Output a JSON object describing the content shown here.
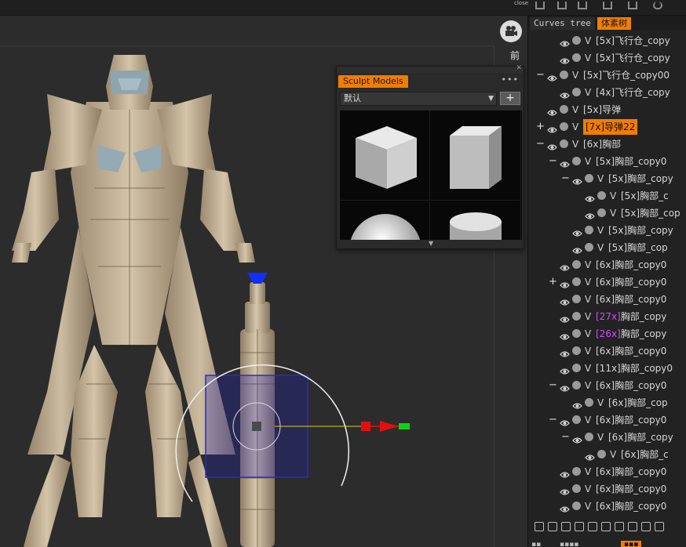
{
  "topbar": {
    "close_label": "close"
  },
  "viewport": {
    "view_label": "前"
  },
  "sculpt_panel": {
    "tab_label": "Sculpt Models",
    "menu_dots": "•••",
    "preset_value": "默认",
    "add_label": "+",
    "models": [
      "cube",
      "cube-beveled",
      "sphere",
      "cylinder"
    ]
  },
  "tree": {
    "tabs": [
      "Curves tree",
      "体素树"
    ],
    "active_tab": 1,
    "rows": [
      {
        "expander": "",
        "v": "V",
        "name": "[5x]飞行仓_copy",
        "selected": false
      },
      {
        "expander": "",
        "v": "V",
        "name": "[5x]飞行仓_copy",
        "selected": false
      },
      {
        "expander": "−",
        "v": "V",
        "name": "[5x]飞行仓_copy00",
        "selected": false
      },
      {
        "expander": "",
        "v": "V",
        "name": "[4x]飞行仓_copy",
        "selected": false
      },
      {
        "expander": "",
        "v": "V",
        "name": "[5x]导弹",
        "selected": false
      },
      {
        "expander": "+",
        "v": "V",
        "name": "[7x]导弹22",
        "selected": true
      },
      {
        "expander": "−",
        "v": "V",
        "name": "[6x]胸部",
        "selected": false
      },
      {
        "expander": "−",
        "v": "V",
        "name": "[5x]胸部_copy0",
        "selected": false
      },
      {
        "expander": "−",
        "v": "V",
        "name": "[5x]胸部_copy",
        "selected": false
      },
      {
        "expander": "",
        "v": "V",
        "name": "[5x]胸部_c",
        "selected": false
      },
      {
        "expander": "",
        "v": "V",
        "name": "[5x]胸部_cop",
        "selected": false
      },
      {
        "expander": "",
        "v": "V",
        "name": "[5x]胸部_copy",
        "selected": false
      },
      {
        "expander": "",
        "v": "V",
        "name": "[5x]胸部_cop",
        "selected": false
      },
      {
        "expander": "",
        "v": "V",
        "name": "[6x]胸部_copy0",
        "selected": false
      },
      {
        "expander": "+",
        "v": "V",
        "name": "[6x]胸部_copy0",
        "selected": false
      },
      {
        "expander": "",
        "v": "V",
        "name": "[6x]胸部_copy0",
        "selected": false
      },
      {
        "expander": "",
        "v": "V",
        "name": "[27x]胸部_copy",
        "selected": false,
        "highlight": true
      },
      {
        "expander": "",
        "v": "V",
        "name": "[26x]胸部_copy",
        "selected": false,
        "highlight": true
      },
      {
        "expander": "",
        "v": "V",
        "name": "[6x]胸部_copy0",
        "selected": false
      },
      {
        "expander": "",
        "v": "V",
        "name": "[11x]胸部_copy0",
        "selected": false
      },
      {
        "expander": "−",
        "v": "V",
        "name": "[6x]胸部_copy0",
        "selected": false
      },
      {
        "expander": "",
        "v": "V",
        "name": "[6x]胸部_cop",
        "selected": false
      },
      {
        "expander": "−",
        "v": "V",
        "name": "[6x]胸部_copy0",
        "selected": false
      },
      {
        "expander": "−",
        "v": "V",
        "name": "[6x]胸部_copy",
        "selected": false
      },
      {
        "expander": "",
        "v": "V",
        "name": "[6x]胸部_c",
        "selected": false
      },
      {
        "expander": "",
        "v": "V",
        "name": "[6x]胸部_copy0",
        "selected": false
      },
      {
        "expander": "",
        "v": "V",
        "name": "[6x]胸部_copy0",
        "selected": false
      },
      {
        "expander": "",
        "v": "V",
        "name": "[6x]胸部_copy0",
        "selected": false
      }
    ],
    "bottom_icons": [
      "add-icon",
      "duplicate-icon",
      "sphere-icon",
      "merge-icon",
      "split-icon",
      "transform-icon",
      "grid-icon",
      "export-icon",
      "delete-icon",
      "hide-icon"
    ]
  },
  "colors": {
    "accent": "#f07d00",
    "gizmo_x": "#e01010",
    "gizmo_y": "#10d010",
    "gizmo_z": "#1030ff",
    "model": "#c8b79c"
  }
}
